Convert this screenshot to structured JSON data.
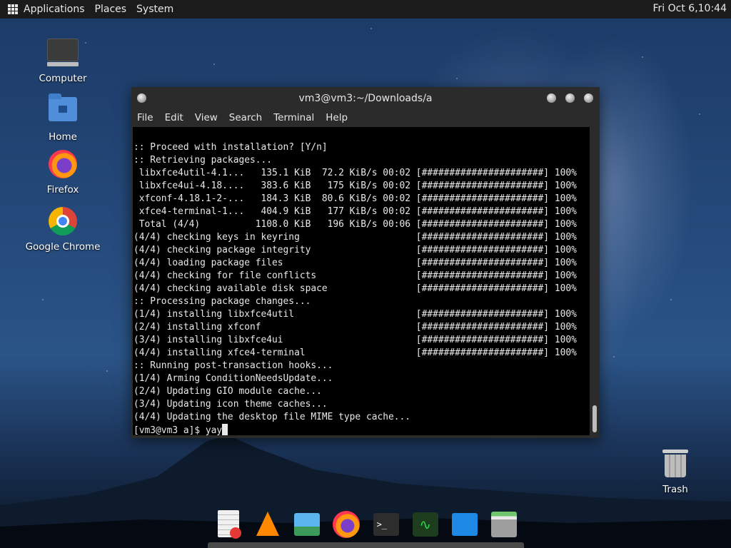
{
  "top_panel": {
    "menus": [
      "Applications",
      "Places",
      "System"
    ],
    "clock": "Fri Oct  6,10:44"
  },
  "desktop_icons": [
    {
      "label": "Computer",
      "icon": "computer-icon"
    },
    {
      "label": "Home",
      "icon": "home-folder-icon"
    },
    {
      "label": "Firefox",
      "icon": "firefox-icon"
    },
    {
      "label": "Google Chrome",
      "icon": "chrome-icon"
    },
    {
      "label": "Trash",
      "icon": "trash-icon"
    }
  ],
  "window": {
    "title": "vm3@vm3:~/Downloads/a",
    "menu": [
      "File",
      "Edit",
      "View",
      "Search",
      "Terminal",
      "Help"
    ]
  },
  "terminal": {
    "lines": [
      ":: Proceed with installation? [Y/n]",
      ":: Retrieving packages...",
      " libxfce4util-4.1...   135.1 KiB  72.2 KiB/s 00:02 [######################] 100%",
      " libxfce4ui-4.18....   383.6 KiB   175 KiB/s 00:02 [######################] 100%",
      " xfconf-4.18.1-2-...   184.3 KiB  80.6 KiB/s 00:02 [######################] 100%",
      " xfce4-terminal-1...   404.9 KiB   177 KiB/s 00:02 [######################] 100%",
      " Total (4/4)          1108.0 KiB   196 KiB/s 00:06 [######################] 100%",
      "(4/4) checking keys in keyring                     [######################] 100%",
      "(4/4) checking package integrity                   [######################] 100%",
      "(4/4) loading package files                        [######################] 100%",
      "(4/4) checking for file conflicts                  [######################] 100%",
      "(4/4) checking available disk space                [######################] 100%",
      ":: Processing package changes...",
      "(1/4) installing libxfce4util                      [######################] 100%",
      "(2/4) installing xfconf                            [######################] 100%",
      "(3/4) installing libxfce4ui                        [######################] 100%",
      "(4/4) installing xfce4-terminal                    [######################] 100%",
      ":: Running post-transaction hooks...",
      "(1/4) Arming ConditionNeedsUpdate...",
      "(2/4) Updating GIO module cache...",
      "(3/4) Updating icon theme caches...",
      "(4/4) Updating the desktop file MIME type cache..."
    ],
    "prompt": "[vm3@vm3 a]$ yay"
  },
  "dock": [
    "text-editor-icon",
    "vlc-icon",
    "image-viewer-icon",
    "firefox-icon",
    "terminal-icon",
    "system-monitor-icon",
    "window-icon",
    "file-manager-icon"
  ]
}
